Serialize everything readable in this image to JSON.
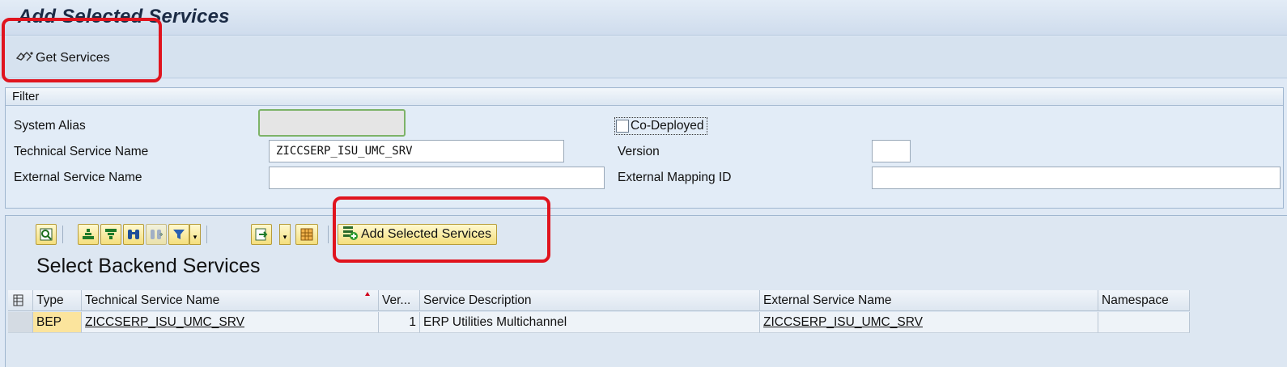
{
  "window": {
    "title": "Add Selected Services"
  },
  "toolbar": {
    "get_services_label": "Get Services"
  },
  "filter": {
    "group_title": "Filter",
    "system_alias_label": "System Alias",
    "system_alias_value": "",
    "codeployed_label": "Co-Deployed",
    "technical_name_label": "Technical Service Name",
    "technical_name_value": "ZICCSERP_ISU_UMC_SRV",
    "version_label": "Version",
    "version_value": "",
    "external_name_label": "External Service Name",
    "external_name_value": "",
    "external_mapping_label": "External Mapping ID",
    "external_mapping_value": ""
  },
  "alv": {
    "add_selected_label": "Add Selected Services",
    "title": "Select Backend Services",
    "columns": [
      "Type",
      "Technical Service Name",
      "Ver...",
      "Service Description",
      "External Service Name",
      "Namespace"
    ],
    "rows": [
      {
        "type": "BEP",
        "technical_name": "ZICCSERP_ISU_UMC_SRV",
        "version": "1",
        "description": "ERP Utilities Multichannel",
        "external_name": "ZICCSERP_ISU_UMC_SRV",
        "namespace": ""
      }
    ]
  },
  "icons": [
    "get-services-icon",
    "details-icon",
    "sort-asc-icon",
    "sort-desc-icon",
    "find-icon",
    "find-next-icon",
    "filter-icon",
    "export-icon",
    "layout-icon",
    "add-services-icon",
    "column-select-icon"
  ],
  "colors": {
    "annotation": "#e0141e",
    "toolbar_button": "#f4de7c",
    "type_cell": "#fbe49d"
  }
}
